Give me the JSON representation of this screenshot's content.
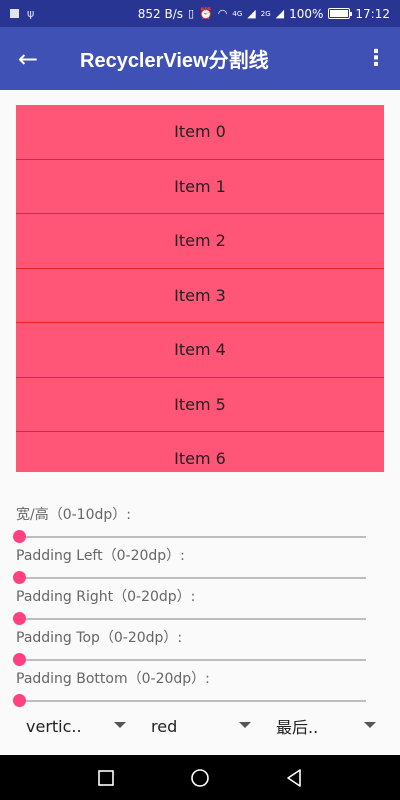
{
  "status_bar": {
    "speed": "852 B/s",
    "network_tag": "4G",
    "network_tag2": "2G",
    "battery_percent": "100%",
    "battery_level": 1.0,
    "time": "17:12",
    "icons": [
      "square-icon",
      "usb-icon",
      "vibrate-icon",
      "alarm-icon",
      "wifi-icon",
      "signal-icon",
      "battery-icon"
    ]
  },
  "app_bar": {
    "title": "RecyclerView分割线",
    "back_icon": "arrow-left-icon",
    "menu_icon": "more-vert-icon"
  },
  "list": {
    "items": [
      "Item 0",
      "Item 1",
      "Item 2",
      "Item 3",
      "Item 4",
      "Item 5",
      "Item 6"
    ],
    "item_color": "#ff5577",
    "divider_color": "#e8232f"
  },
  "controls": {
    "sliders": [
      {
        "label": "宽/高（0-10dp）:",
        "value": 0
      },
      {
        "label": "Padding Left（0-20dp）:",
        "value": 0
      },
      {
        "label": "Padding Right（0-20dp）:",
        "value": 0
      },
      {
        "label": "Padding Top（0-20dp）:",
        "value": 0
      },
      {
        "label": "Padding Bottom（0-20dp）:",
        "value": 0
      }
    ],
    "accent_color": "#ff4081"
  },
  "spinners": [
    {
      "value": "vertic.."
    },
    {
      "value": "red"
    },
    {
      "value": "最后.."
    }
  ],
  "theme": {
    "primary": "#3f51b5",
    "primary_dark": "#283593"
  }
}
